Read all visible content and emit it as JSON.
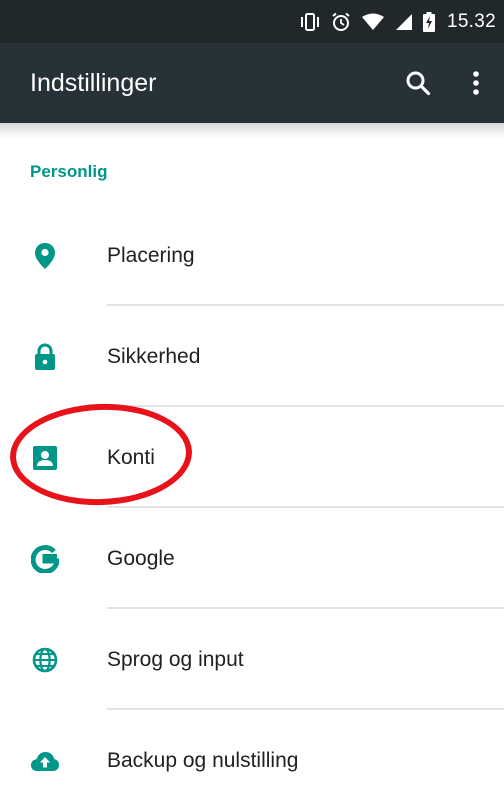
{
  "status_bar": {
    "icons": [
      "vibrate-icon",
      "alarm-icon",
      "wifi-icon",
      "signal-icon",
      "battery-charging-icon"
    ],
    "time": "15.32"
  },
  "toolbar": {
    "title": "Indstillinger",
    "actions": [
      "search-icon",
      "more-vert-icon"
    ]
  },
  "section": {
    "header": "Personlig"
  },
  "items": [
    {
      "label": "Placering",
      "icon": "location-pin-icon"
    },
    {
      "label": "Sikkerhed",
      "icon": "lock-icon"
    },
    {
      "label": "Konti",
      "icon": "account-box-icon"
    },
    {
      "label": "Google",
      "icon": "google-g-icon"
    },
    {
      "label": "Sprog og input",
      "icon": "globe-icon"
    },
    {
      "label": "Backup og nulstilling",
      "icon": "cloud-upload-icon"
    }
  ],
  "colors": {
    "status_bar": "#20282b",
    "toolbar": "#263238",
    "accent": "#009688",
    "annotation": "#e8121a"
  }
}
